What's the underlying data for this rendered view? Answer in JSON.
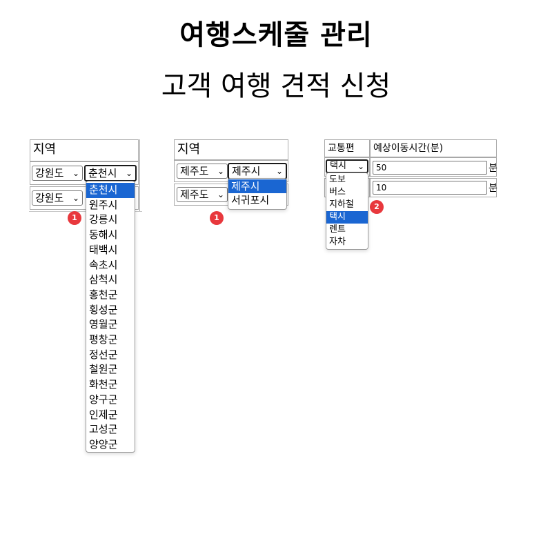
{
  "header": {
    "title": "여행스케줄 관리",
    "subtitle": "고객 여행 견적 신청"
  },
  "panel1": {
    "header_label": "지역",
    "row1": {
      "province": "강원도",
      "city": "춘천시"
    },
    "row2": {
      "province": "강원도"
    },
    "dropdown_items": [
      "춘천시",
      "원주시",
      "강릉시",
      "동해시",
      "태백시",
      "속초시",
      "삼척시",
      "홍천군",
      "횡성군",
      "영월군",
      "평창군",
      "정선군",
      "철원군",
      "화천군",
      "양구군",
      "인제군",
      "고성군",
      "양양군"
    ],
    "selected_index": 0,
    "badge": "1"
  },
  "panel2": {
    "header_label": "지역",
    "row1": {
      "province": "제주도",
      "city": "제주시"
    },
    "row2": {
      "province": "제주도"
    },
    "dropdown_items": [
      "제주시",
      "서귀포시"
    ],
    "selected_index": 0,
    "badge": "1"
  },
  "panel3": {
    "col_transport": "교통편",
    "col_time": "예상이동시간(분)",
    "row1": {
      "transport": "택시",
      "time": "50",
      "unit": "분"
    },
    "row2": {
      "time": "10",
      "unit": "분"
    },
    "dropdown_items": [
      "도보",
      "버스",
      "지하철",
      "택시",
      "렌트",
      "자차"
    ],
    "selected_index": 3,
    "badge": "2"
  },
  "colors": {
    "selected_bg": "#1a66d2",
    "badge": "#e8383d"
  }
}
